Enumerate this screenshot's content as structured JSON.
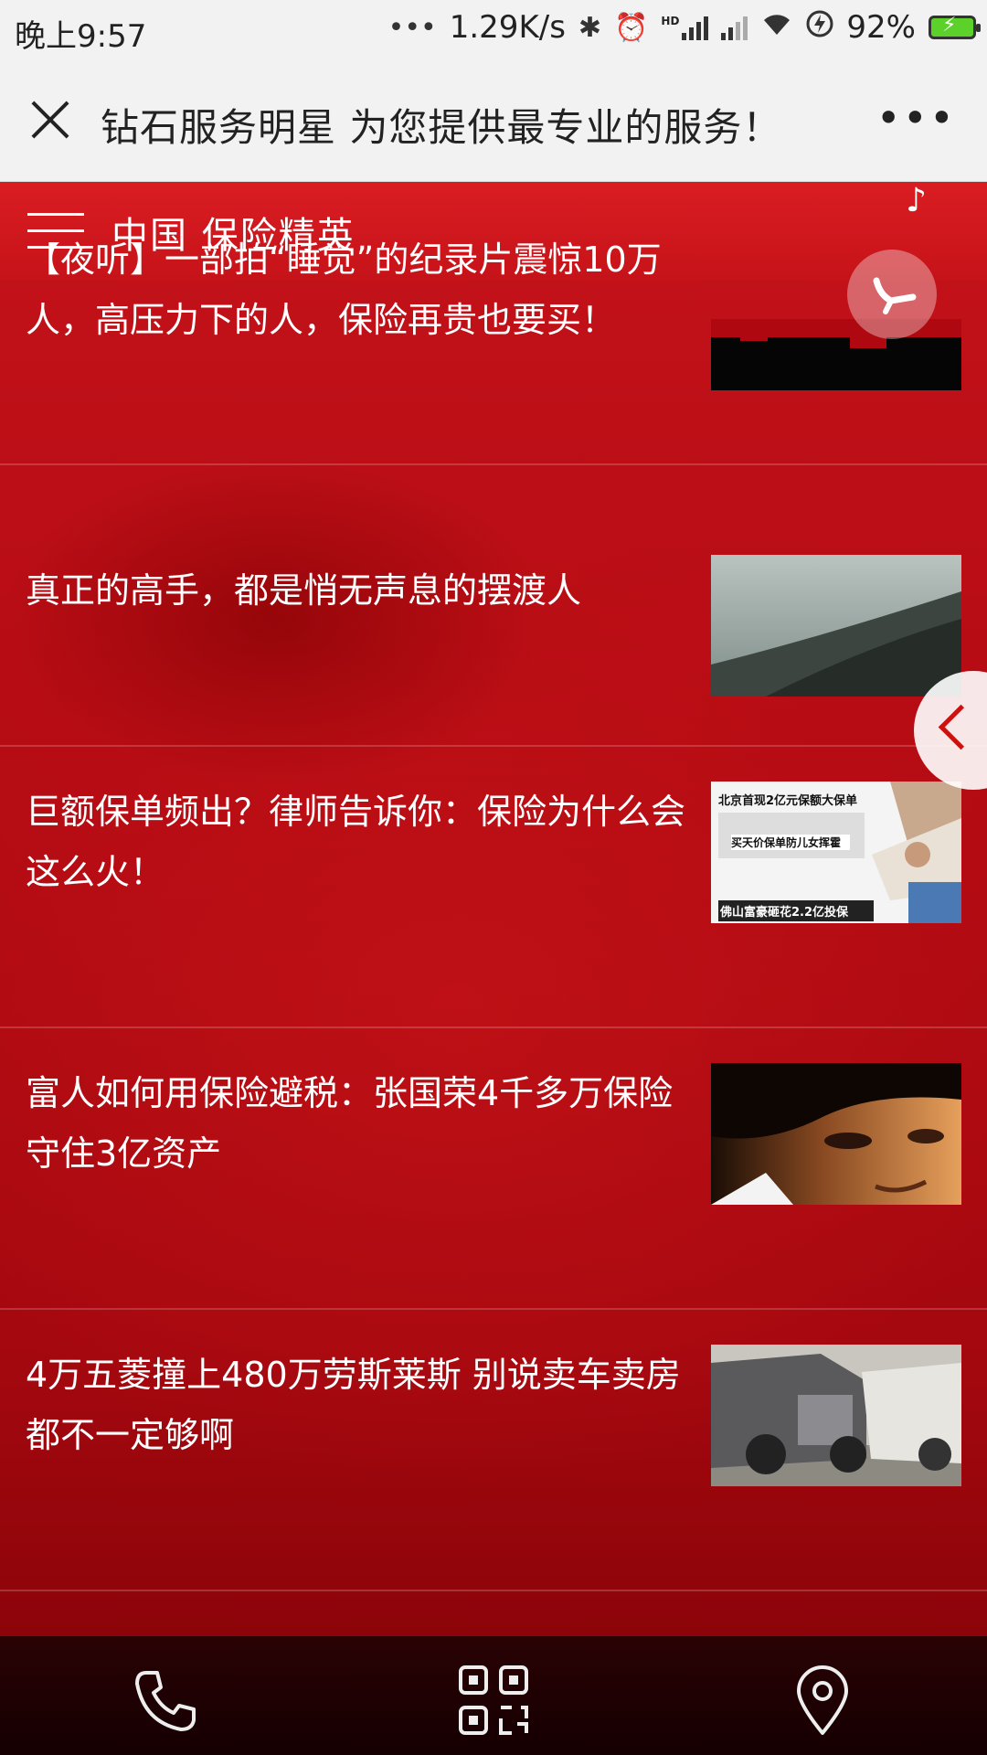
{
  "status_bar": {
    "time": "晚上9:57",
    "dots": "•••",
    "network_speed": "1.29K/s",
    "hd": "HD",
    "battery_text": "92%",
    "battery_color": "#5bd12a"
  },
  "titlebar": {
    "title": "钻石服务明星 为您提供最专业的服务！",
    "more": "•••"
  },
  "nav": {
    "brand": "中国 保险精英"
  },
  "articles": [
    {
      "title": "【夜听】一部拍“睡觉”的纪录片震惊10万人，高压力下的人，保险再贵也要买！"
    },
    {
      "title": "真正的高手，都是悄无声息的摆渡人"
    },
    {
      "title": "巨额保单频出？律师告诉你：保险为什么会这么火！"
    },
    {
      "title": "富人如何用保险避税：张国荣4千多万保险守住3亿资产"
    },
    {
      "title": "4万五菱撞上480万劳斯莱斯 别说卖车卖房都不一定够啊"
    }
  ],
  "thumb3": {
    "headline1": "北京首现2亿元保额大保单",
    "headline2": "买天价保单防儿女挥霍",
    "headline3": "佛山富豪砸花2.2亿投保"
  },
  "colors": {
    "accent_red": "#b00810",
    "bottom_bar": "#150002"
  },
  "bottom_bar": {
    "icons": [
      "phone-icon",
      "qrcode-icon",
      "location-icon"
    ]
  }
}
